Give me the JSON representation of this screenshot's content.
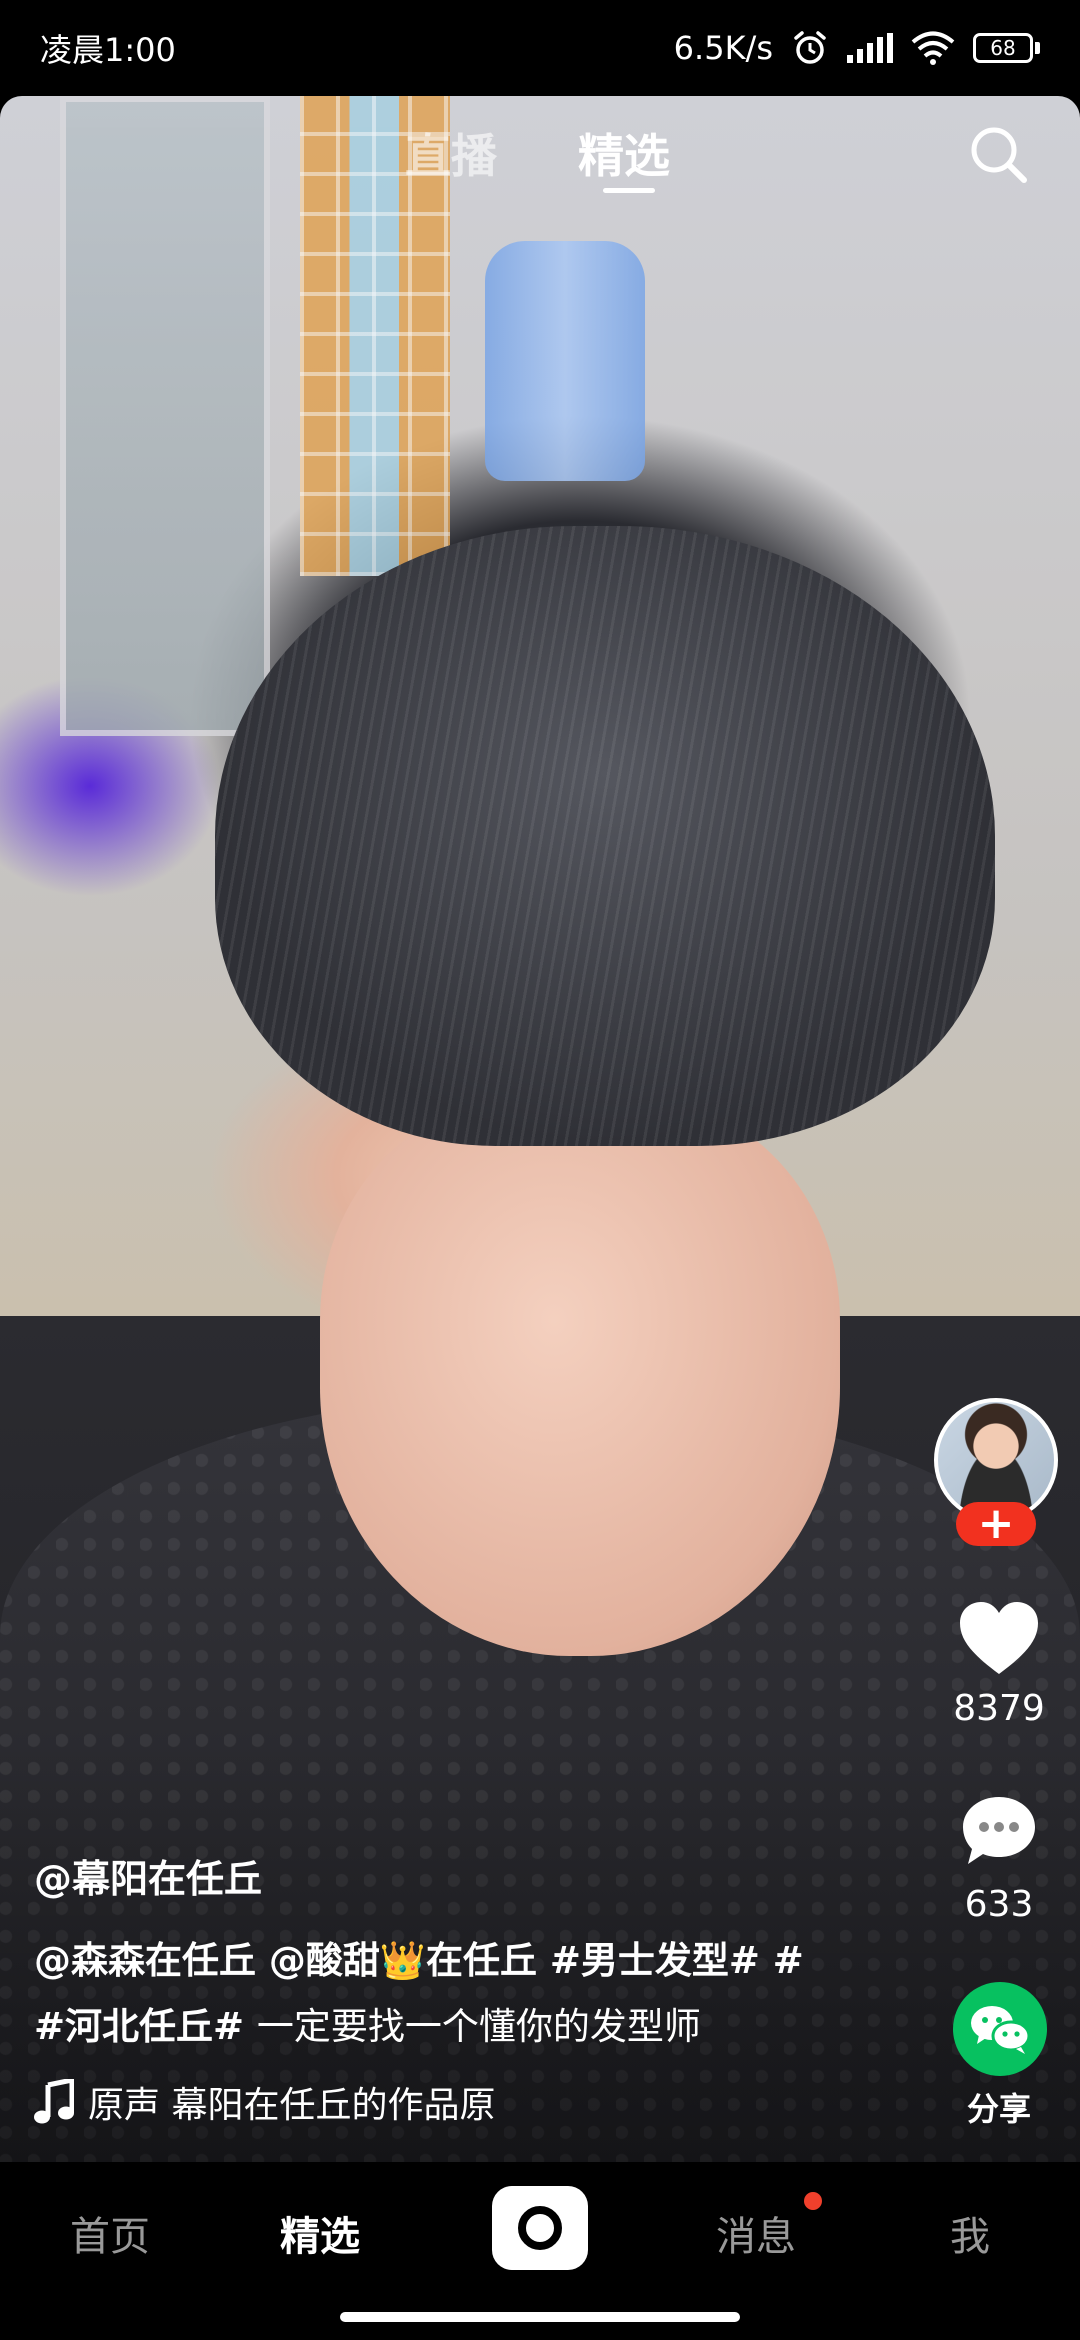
{
  "status_bar": {
    "time": "凌晨1:00",
    "network_speed": "6.5K/s",
    "battery_level": "68",
    "icons": [
      "alarm-icon",
      "signal-icon",
      "wifi-icon",
      "battery-icon"
    ]
  },
  "top_tabs": {
    "items": [
      {
        "label": "直播",
        "active": false
      },
      {
        "label": "精选",
        "active": true
      }
    ],
    "search_icon": "search-icon"
  },
  "video": {
    "author": "@幕阳在任丘",
    "caption": {
      "mention_1": "@森森在任丘",
      "mention_2": "@酸甜",
      "crown_emoji": "👑",
      "mention_2_suffix": "在任丘",
      "tag_1": "#男士发型#",
      "tag_2": "#河北任丘#",
      "text": "一定要找一个懂你的发型师"
    },
    "music": {
      "text": "原声    幕阳在任丘的作品原"
    }
  },
  "actions": {
    "follow_label": "+",
    "like_count": "8379",
    "comment_count": "633",
    "share_label": "分享"
  },
  "bottom_nav": {
    "home": "首页",
    "featured": "精选",
    "messages": "消息",
    "me": "我"
  },
  "colors": {
    "follow_badge": "#f2311f",
    "share_green": "#07c160",
    "notification_dot": "#f0402c"
  }
}
